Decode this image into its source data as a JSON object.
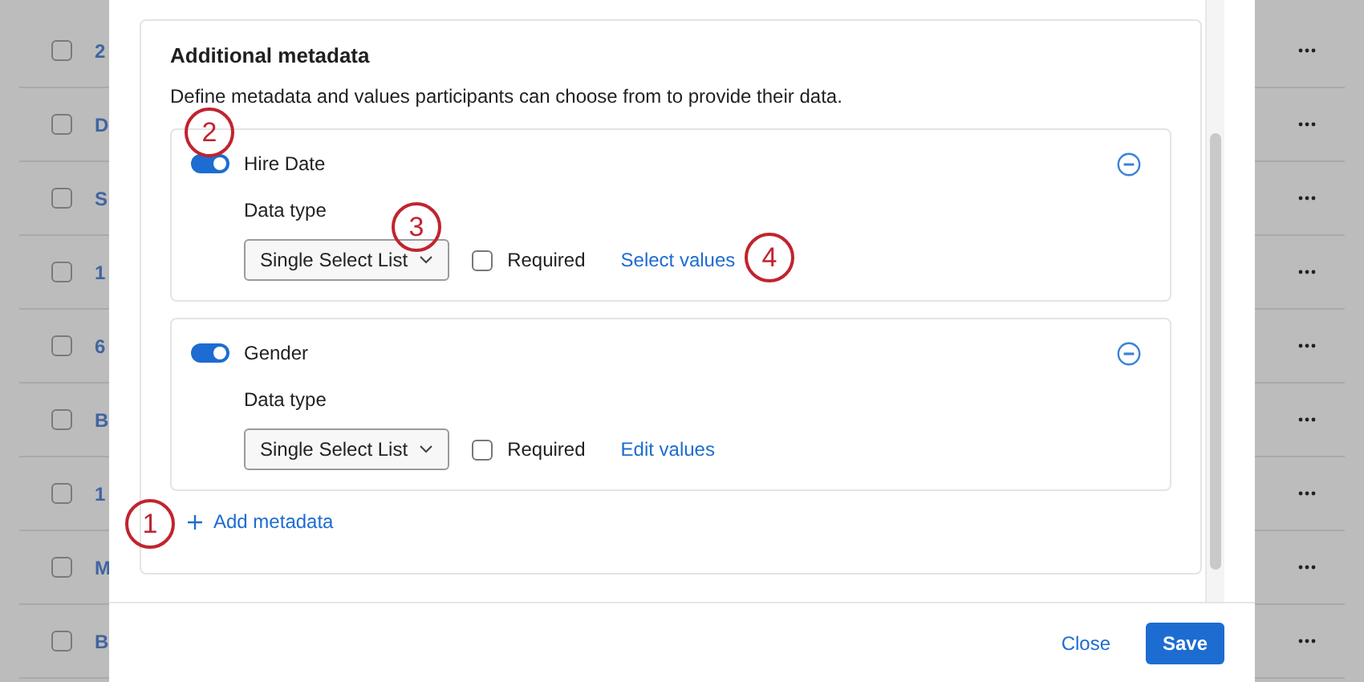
{
  "background_table": {
    "rows": [
      {
        "text": "2",
        "checked": false
      },
      {
        "text": "D",
        "checked": false
      },
      {
        "text": "S",
        "checked": false
      },
      {
        "text": "1",
        "checked": false
      },
      {
        "text": "6",
        "checked": false
      },
      {
        "text": "B",
        "checked": false
      },
      {
        "text": "1",
        "checked": false
      },
      {
        "text": "M",
        "checked": false
      },
      {
        "text": "B",
        "checked": false
      }
    ]
  },
  "dialog": {
    "section": {
      "title": "Additional metadata",
      "description": "Define metadata and values participants can choose from to provide their data.",
      "items": [
        {
          "enabled": true,
          "name": "Hire Date",
          "data_type_label": "Data type",
          "data_type": "Single Select List",
          "required": false,
          "required_label": "Required",
          "values_link": "Select values"
        },
        {
          "enabled": true,
          "name": "Gender",
          "data_type_label": "Data type",
          "data_type": "Single Select List",
          "required": false,
          "required_label": "Required",
          "values_link": "Edit values"
        }
      ],
      "add_button": "Add metadata"
    },
    "buttons": {
      "close": "Close",
      "save": "Save"
    }
  },
  "callouts": [
    {
      "number": "1"
    },
    {
      "number": "2"
    },
    {
      "number": "3"
    },
    {
      "number": "4"
    }
  ]
}
